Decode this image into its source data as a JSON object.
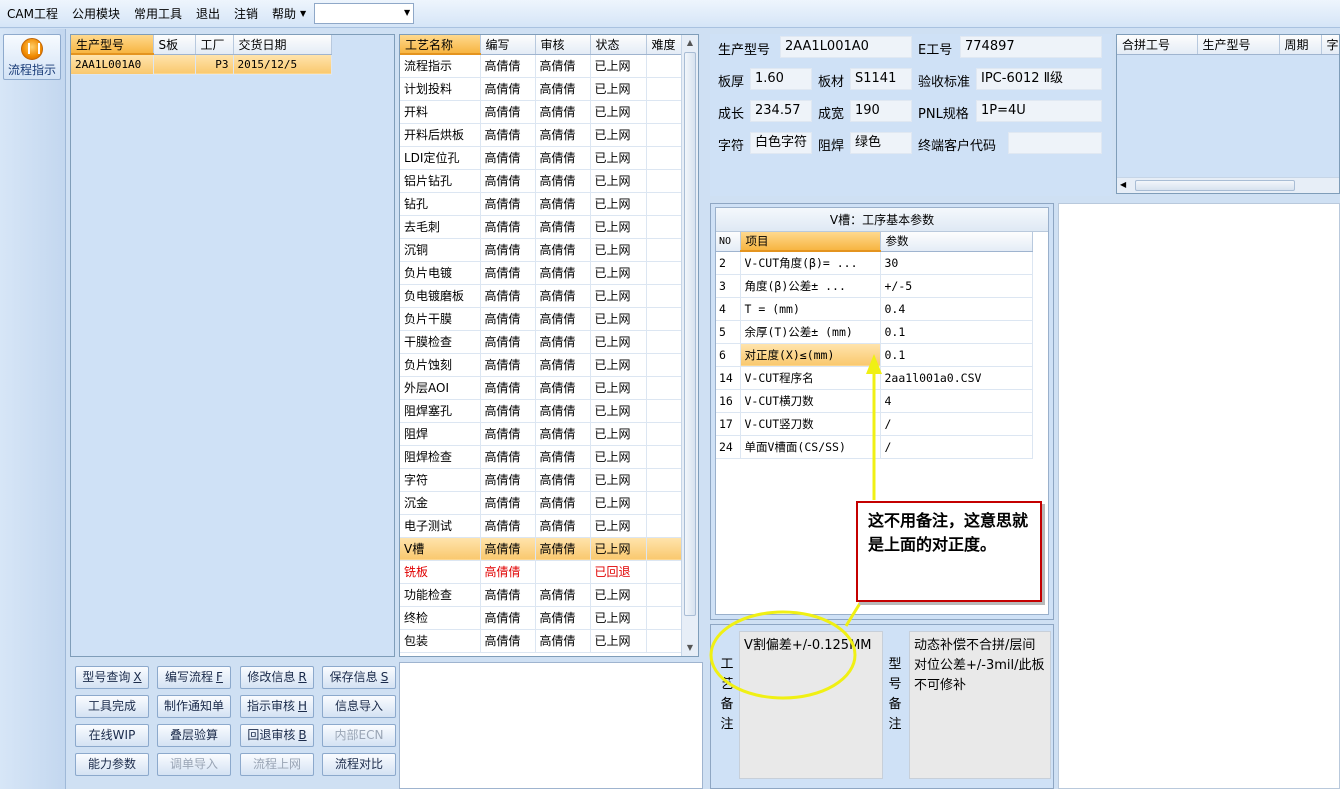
{
  "menu": {
    "items": [
      "CAM工程",
      "公用模块",
      "常用工具",
      "退出",
      "注销",
      "帮助"
    ],
    "combo_value": ""
  },
  "left_bar": {
    "flow_button_label": "流程指示"
  },
  "model_table": {
    "headers": [
      "生产型号",
      "S板",
      "工厂",
      "交货日期"
    ],
    "rows": [
      [
        "2AA1L001A0",
        "",
        "P3",
        "2015/12/5"
      ]
    ]
  },
  "process_table": {
    "headers": [
      "工艺名称",
      "编写",
      "审核",
      "状态",
      "难度"
    ],
    "rows": [
      [
        "流程指示",
        "高倩倩",
        "高倩倩",
        "已上网",
        ""
      ],
      [
        "计划投料",
        "高倩倩",
        "高倩倩",
        "已上网",
        ""
      ],
      [
        "开料",
        "高倩倩",
        "高倩倩",
        "已上网",
        ""
      ],
      [
        "开料后烘板",
        "高倩倩",
        "高倩倩",
        "已上网",
        ""
      ],
      [
        "LDI定位孔",
        "高倩倩",
        "高倩倩",
        "已上网",
        ""
      ],
      [
        "铝片钻孔",
        "高倩倩",
        "高倩倩",
        "已上网",
        ""
      ],
      [
        "钻孔",
        "高倩倩",
        "高倩倩",
        "已上网",
        ""
      ],
      [
        "去毛刺",
        "高倩倩",
        "高倩倩",
        "已上网",
        ""
      ],
      [
        "沉铜",
        "高倩倩",
        "高倩倩",
        "已上网",
        ""
      ],
      [
        "负片电镀",
        "高倩倩",
        "高倩倩",
        "已上网",
        ""
      ],
      [
        "负电镀磨板",
        "高倩倩",
        "高倩倩",
        "已上网",
        ""
      ],
      [
        "负片干膜",
        "高倩倩",
        "高倩倩",
        "已上网",
        ""
      ],
      [
        "干膜检查",
        "高倩倩",
        "高倩倩",
        "已上网",
        ""
      ],
      [
        "负片蚀刻",
        "高倩倩",
        "高倩倩",
        "已上网",
        ""
      ],
      [
        "外层AOI",
        "高倩倩",
        "高倩倩",
        "已上网",
        ""
      ],
      [
        "阻焊塞孔",
        "高倩倩",
        "高倩倩",
        "已上网",
        ""
      ],
      [
        "阻焊",
        "高倩倩",
        "高倩倩",
        "已上网",
        ""
      ],
      [
        "阻焊检查",
        "高倩倩",
        "高倩倩",
        "已上网",
        ""
      ],
      [
        "字符",
        "高倩倩",
        "高倩倩",
        "已上网",
        ""
      ],
      [
        "沉金",
        "高倩倩",
        "高倩倩",
        "已上网",
        ""
      ],
      [
        "电子测试",
        "高倩倩",
        "高倩倩",
        "已上网",
        ""
      ],
      [
        "V槽",
        "高倩倩",
        "高倩倩",
        "已上网",
        ""
      ],
      [
        "铣板",
        "高倩倩",
        "",
        "已回退",
        ""
      ],
      [
        "功能检查",
        "高倩倩",
        "高倩倩",
        "已上网",
        ""
      ],
      [
        "终检",
        "高倩倩",
        "高倩倩",
        "已上网",
        ""
      ],
      [
        "包装",
        "高倩倩",
        "高倩倩",
        "已上网",
        ""
      ]
    ],
    "selected_index": 21,
    "returned_index": 22
  },
  "info": {
    "model_label": "生产型号",
    "model_value": "2AA1L001A0",
    "eno_label": "E工号",
    "eno_value": "774897",
    "thick_label": "板厚",
    "thick_value": "1.60",
    "material_label": "板材",
    "material_value": "S1141",
    "standard_label": "验收标准",
    "standard_value": "IPC-6012 Ⅱ级",
    "length_label": "成长",
    "length_value": "234.57",
    "width_label": "成宽",
    "width_value": "190",
    "pnl_label": "PNL规格",
    "pnl_value": "1P=4U",
    "char_label": "字符",
    "char_value": "白色字符",
    "mask_label": "阻焊",
    "mask_value": "绿色",
    "customer_label": "终端客户代码",
    "customer_value": ""
  },
  "merge_table": {
    "headers": [
      "合拼工号",
      "生产型号",
      "周期",
      "字符"
    ]
  },
  "params": {
    "title": "V槽：工序基本参数",
    "headers": [
      "NO",
      "项目",
      "参数"
    ],
    "rows": [
      [
        "2",
        "V-CUT角度(β)=  ...",
        "30"
      ],
      [
        "3",
        "角度(β)公差±  ...",
        "+/-5"
      ],
      [
        "4",
        "T =  (mm)",
        "0.4"
      ],
      [
        "5",
        "余厚(T)公差±  (mm)",
        "0.1"
      ],
      [
        "6",
        "对正度(X)≤(mm)",
        "0.1"
      ],
      [
        "14",
        "V-CUT程序名",
        "2aa1l001a0.CSV"
      ],
      [
        "16",
        "V-CUT横刀数",
        "4"
      ],
      [
        "17",
        "V-CUT竖刀数",
        "/"
      ],
      [
        "24",
        "单面V槽面(CS/SS)",
        "/"
      ]
    ],
    "highlight_index": 4
  },
  "callout_text": "这不用备注，这意思就是上面的对正度。",
  "buttons": [
    {
      "label": "型号查询",
      "key": "X",
      "enabled": true
    },
    {
      "label": "编写流程",
      "key": "F",
      "enabled": true
    },
    {
      "label": "修改信息",
      "key": "R",
      "enabled": true
    },
    {
      "label": "保存信息",
      "key": "S",
      "enabled": true
    },
    {
      "label": "工具完成",
      "key": "",
      "enabled": true
    },
    {
      "label": "制作通知单",
      "key": "",
      "enabled": true
    },
    {
      "label": "指示审核",
      "key": "H",
      "enabled": true
    },
    {
      "label": "信息导入",
      "key": "",
      "enabled": true
    },
    {
      "label": "在线WIP",
      "key": "",
      "enabled": true
    },
    {
      "label": "叠层验算",
      "key": "",
      "enabled": true
    },
    {
      "label": "回退审核",
      "key": "B",
      "enabled": true
    },
    {
      "label": "内部ECN",
      "key": "",
      "enabled": false
    },
    {
      "label": "能力参数",
      "key": "",
      "enabled": true
    },
    {
      "label": "调单导入",
      "key": "",
      "enabled": false
    },
    {
      "label": "流程上网",
      "key": "",
      "enabled": false
    },
    {
      "label": "流程对比",
      "key": "",
      "enabled": true
    }
  ],
  "notes": {
    "process_label": "工艺备注",
    "process_text": "V割偏差+/-0.125MM",
    "model_label": "型号备注",
    "model_text": "动态补偿不合拼/层间对位公差+/-3mil/此板不可修补"
  }
}
